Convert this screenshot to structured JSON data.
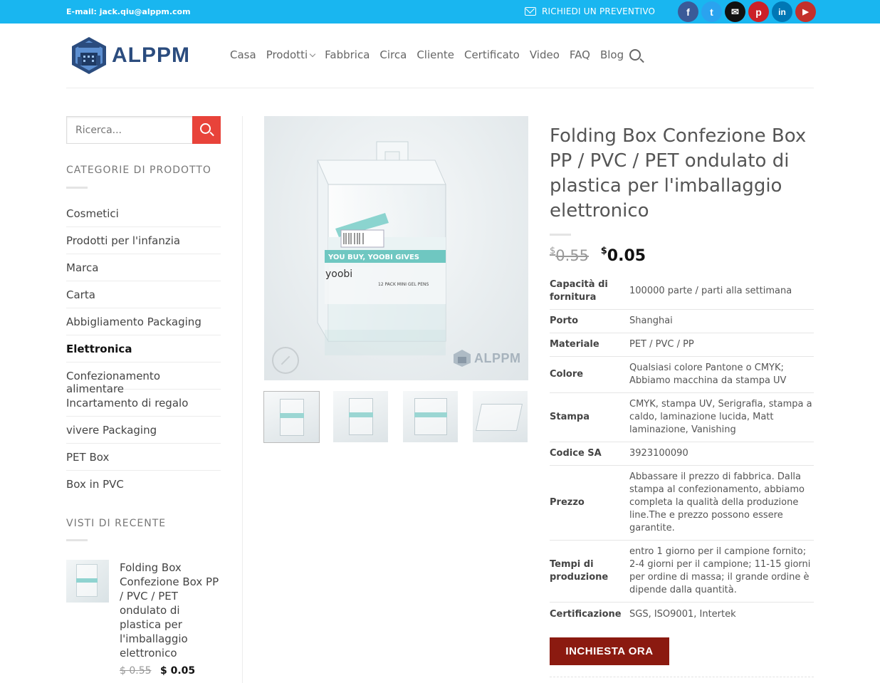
{
  "topbar": {
    "email": "E-mail: jack.qiu@alppm.com",
    "quote": "RICHIEDI UN PREVENTIVO",
    "social": [
      {
        "icon": "facebook-icon",
        "glyph": "f",
        "color": "#3a5a98"
      },
      {
        "icon": "twitter-icon",
        "glyph": "t",
        "color": "#2aa3ef"
      },
      {
        "icon": "email-icon",
        "glyph": "✉",
        "color": "#111111"
      },
      {
        "icon": "pinterest-icon",
        "glyph": "p",
        "color": "#cb2027"
      },
      {
        "icon": "linkedin-icon",
        "glyph": "in",
        "color": "#0077b5"
      },
      {
        "icon": "youtube-icon",
        "glyph": "▶",
        "color": "#c4302b"
      }
    ]
  },
  "logo": {
    "text": "ALPPM",
    "badge": "ALPPM"
  },
  "nav": {
    "items": [
      "Casa",
      "Prodotti",
      "Fabbrica",
      "Circa",
      "Cliente",
      "Certificato",
      "Video",
      "FAQ",
      "Blog"
    ]
  },
  "sidebar": {
    "search_placeholder": "Ricerca...",
    "categories_title": "CATEGORIE DI PRODOTTO",
    "categories": [
      "Cosmetici",
      "Prodotti per l'infanzia",
      "Marca",
      "Carta",
      "Abbigliamento Packaging",
      "Elettronica",
      "Confezionamento alimentare",
      "Incartamento di regalo",
      "vivere Packaging",
      "PET Box",
      "Box in PVC"
    ],
    "active_category": "Elettronica",
    "recent_title": "VISTI DI RECENTE",
    "recent_item": {
      "title": "Folding Box Confezione Box PP / PVC / PET ondulato di plastica per l'imballaggio elettronico",
      "old_price": "$ 0.55",
      "new_price": "$ 0.05"
    }
  },
  "gallery": {
    "watermark": "ALPPM",
    "label_text": "YOU BUY, YOOBI GIVES",
    "brand": "yoobi",
    "pack": "12 PACK MINI GEL PENS"
  },
  "product": {
    "title": "Folding Box Confezione Box PP / PVC / PET ondulato di plastica per l'imballaggio elettronico",
    "old_currency": "$",
    "old_price": "0.55",
    "new_currency": "$",
    "new_price": "0.05",
    "specs": [
      {
        "k": "Capacità di fornitura",
        "v": "100000 parte / parti alla settimana"
      },
      {
        "k": "Porto",
        "v": "Shanghai"
      },
      {
        "k": "Materiale",
        "v": "PET / PVC / PP"
      },
      {
        "k": "Colore",
        "v": "Qualsiasi colore Pantone o CMYK; Abbiamo macchina da stampa UV"
      },
      {
        "k": "Stampa",
        "v": "CMYK, stampa UV, Serigrafia, stampa a caldo, laminazione lucida, Matt laminazione, Vanishing"
      },
      {
        "k": "Codice SA",
        "v": "3923100090"
      },
      {
        "k": "Prezzo",
        "v": "Abbassare il prezzo di fabbrica. Dalla stampa al confezionamento, abbiamo completa la qualità della produzione line.The e prezzo possono essere garantite."
      },
      {
        "k": "Tempi di produzione",
        "v": "entro 1 giorno per il campione fornito; 2-4 giorni per il campione; 11-15 giorni per ordine di massa; il grande ordine è dipende dalla quantità."
      },
      {
        "k": "Certificazione",
        "v": "SGS, ISO9001, Intertek"
      }
    ],
    "inquiry_button": "INCHIESTA ORA"
  }
}
